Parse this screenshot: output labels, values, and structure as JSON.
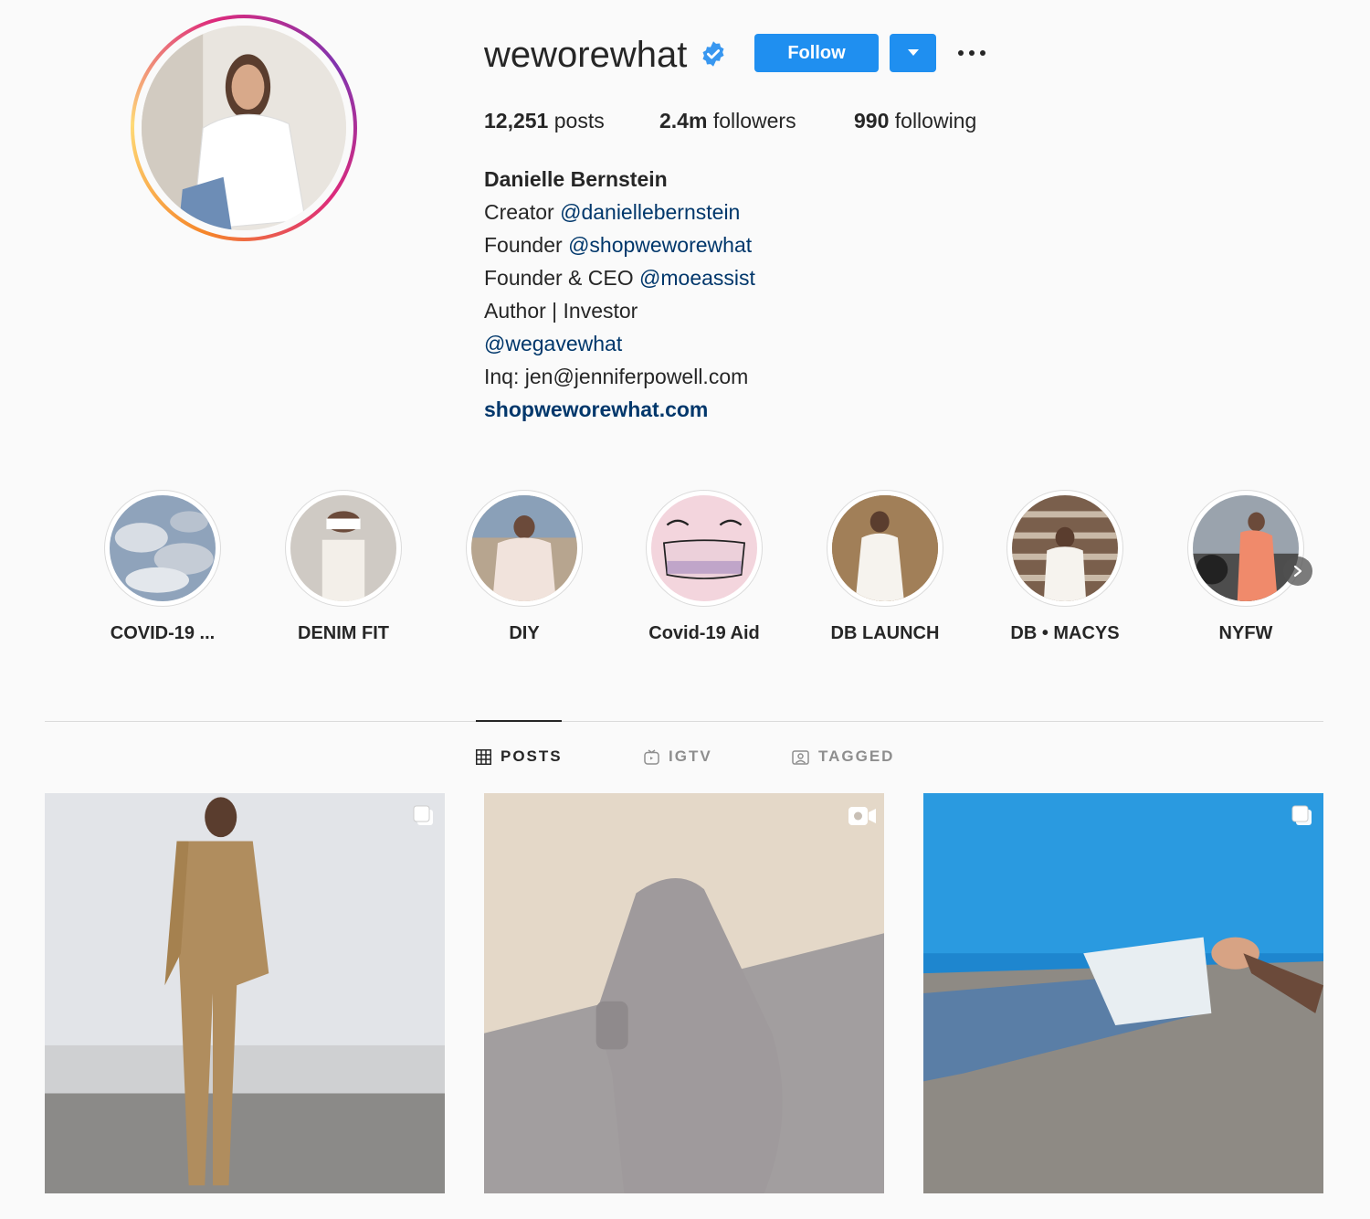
{
  "profile": {
    "username": "weworewhat",
    "follow_label": "Follow",
    "stats": {
      "posts_count": "12,251",
      "posts_label": "posts",
      "followers_count": "2.4m",
      "followers_label": "followers",
      "following_count": "990",
      "following_label": "following"
    },
    "bio": {
      "name": "Danielle Bernstein",
      "line1_prefix": "Creator",
      "line1_link": "@daniellebernstein",
      "line2_prefix": "Founder",
      "line2_link": "@shopweworewhat",
      "line3_prefix": "Founder & CEO",
      "line3_link": "@moeassist",
      "line4": "Author | Investor",
      "line5_link": "@wegavewhat",
      "line6": "Inq: jen@jenniferpowell.com",
      "website": "shopweworewhat.com"
    }
  },
  "highlights": [
    {
      "label": "COVID-19 ..."
    },
    {
      "label": "DENIM FIT"
    },
    {
      "label": "DIY"
    },
    {
      "label": "Covid-19 Aid"
    },
    {
      "label": "DB LAUNCH"
    },
    {
      "label": "DB • MACYS"
    },
    {
      "label": "NYFW"
    }
  ],
  "tabs": [
    {
      "label": "POSTS",
      "icon": "grid-icon",
      "active": true
    },
    {
      "label": "IGTV",
      "icon": "igtv-icon",
      "active": false
    },
    {
      "label": "TAGGED",
      "icon": "tagged-icon",
      "active": false
    }
  ],
  "posts": [
    {
      "type_icon": "carousel-icon"
    },
    {
      "type_icon": "video-icon"
    },
    {
      "type_icon": "carousel-icon"
    }
  ],
  "colors": {
    "accent": "#1f8ff0",
    "link": "#00376b",
    "text": "#262626",
    "muted": "#8e8e8e",
    "background": "#fafafa"
  }
}
